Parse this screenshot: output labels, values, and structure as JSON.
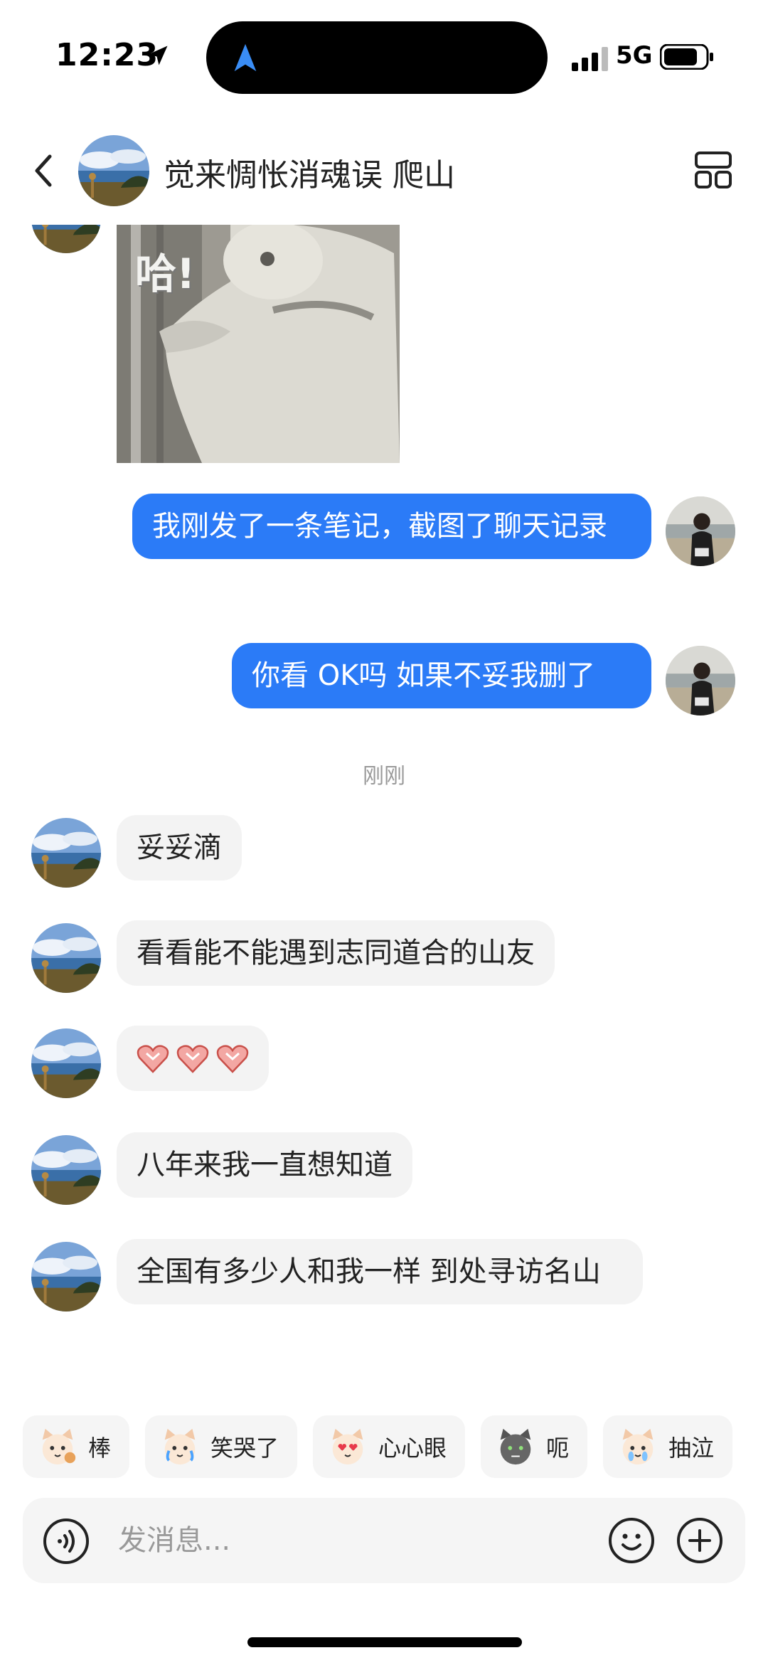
{
  "status_bar": {
    "time": "12:23",
    "network": "5G",
    "icons": [
      "location-arrow-icon",
      "navigation-icon",
      "signal-icon",
      "battery-icon"
    ]
  },
  "header": {
    "title": "觉来惆怅消魂误 爬山",
    "icons": [
      "back-icon",
      "avatar",
      "layout-menu-icon"
    ]
  },
  "meme": {
    "text": "哈!"
  },
  "messages_out": [
    {
      "text": "我刚发了一条笔记，截图了聊天记录"
    },
    {
      "text": "你看 OK吗 如果不妥我删了"
    }
  ],
  "timestamp": "刚刚",
  "messages_in": [
    {
      "text": "妥妥滴"
    },
    {
      "text": "看看能不能遇到志同道合的山友"
    },
    {
      "text": "",
      "emoji": "heart-hands-icon"
    },
    {
      "text": "八年来我一直想知道"
    },
    {
      "text": "全国有多少人和我一样 到处寻访名山"
    }
  ],
  "quick_replies": [
    {
      "label": "棒",
      "icon": "thumbs-cat-icon"
    },
    {
      "label": "笑哭了",
      "icon": "laugh-cry-cat-icon"
    },
    {
      "label": "心心眼",
      "icon": "heart-eyes-cat-icon"
    },
    {
      "label": "呃",
      "icon": "speechless-cat-icon"
    },
    {
      "label": "抽泣",
      "icon": "sob-cat-icon"
    }
  ],
  "input": {
    "placeholder": "发消息..."
  },
  "colors": {
    "accent": "#2b7bf7",
    "incoming_bubble": "#f3f3f3",
    "background": "#ffffff"
  }
}
